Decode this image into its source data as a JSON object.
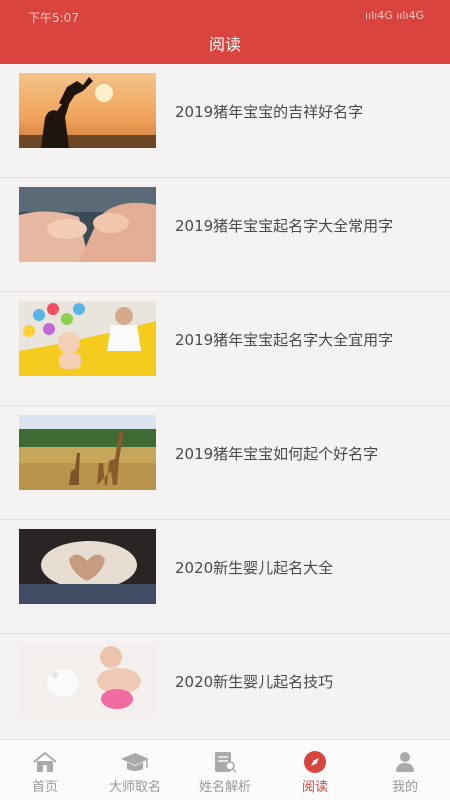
{
  "status_bar": {
    "time": "下午5:07",
    "signal": "ıılı4G ıılı4G"
  },
  "header": {
    "title": "阅读"
  },
  "articles": [
    {
      "title": "2019猪年宝宝的吉祥好名字",
      "image": "mother-lifting-baby-sunset"
    },
    {
      "title": "2019猪年宝宝起名字大全常用字",
      "image": "baby-feet-in-hands"
    },
    {
      "title": "2019猪年宝宝起名字大全宜用字",
      "image": "baby-in-ball-pit"
    },
    {
      "title": "2019猪年宝宝如何起个好名字",
      "image": "giraffes-savanna"
    },
    {
      "title": "2020新生婴儿起名大全",
      "image": "hands-heart-pregnant-belly"
    },
    {
      "title": "2020新生婴儿起名技巧",
      "image": "baby-crawling-with-toy"
    }
  ],
  "tabs": [
    {
      "label": "首页",
      "icon": "home-icon"
    },
    {
      "label": "大师取名",
      "icon": "graduation-cap-icon"
    },
    {
      "label": "姓名解析",
      "icon": "document-icon"
    },
    {
      "label": "阅读",
      "icon": "compass-icon",
      "active": true
    },
    {
      "label": "我的",
      "icon": "user-icon"
    }
  ],
  "colors": {
    "primary": "#d9443f",
    "tab_inactive": "#9a9a9a",
    "text": "#4a4a4a"
  }
}
